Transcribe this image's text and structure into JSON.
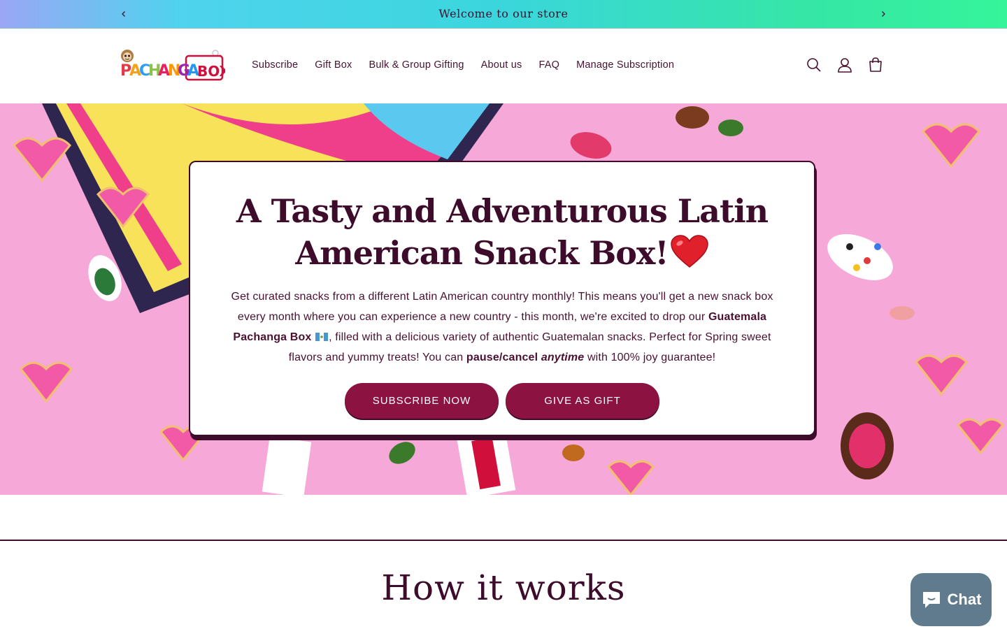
{
  "announcement": {
    "message": "Welcome to our store",
    "prev_icon": "chevron-left-icon",
    "next_icon": "chevron-right-icon"
  },
  "header": {
    "logo_text": "PACHANGA BOX",
    "nav": [
      {
        "label": "Subscribe"
      },
      {
        "label": "Gift Box"
      },
      {
        "label": "Bulk & Group Gifting"
      },
      {
        "label": "About us"
      },
      {
        "label": "FAQ"
      },
      {
        "label": "Manage Subscription"
      }
    ],
    "icons": [
      "search-icon",
      "account-icon",
      "cart-icon"
    ]
  },
  "hero": {
    "title_line1": "A Tasty and Adventurous Latin",
    "title_line2": "American Snack Box!",
    "title_emoji": "heart-icon",
    "body": {
      "part1": "Get curated snacks from a different Latin American country monthly! This means you'll get a new snack box every month where you can experience a new country - this month, we're excited to drop our ",
      "bold1": "Guatemala Pachanga Box",
      "part2": ", filled with a delicious variety of authentic Guatemalan snacks. Perfect for Spring sweet flavors and yummy treats! You can ",
      "bold2": "pause/cancel",
      "italic_bold": "anytime",
      "part3": " with 100% joy guarantee!"
    },
    "buttons": {
      "subscribe": "SUBSCRIBE NOW",
      "gift": "GIVE AS GIFT"
    }
  },
  "section": {
    "how_title": "How it works"
  },
  "chat": {
    "label": "Chat"
  },
  "colors": {
    "primary": "#8c1241",
    "dark": "#3d0c2a",
    "hero_pink": "#f6a8d8"
  }
}
